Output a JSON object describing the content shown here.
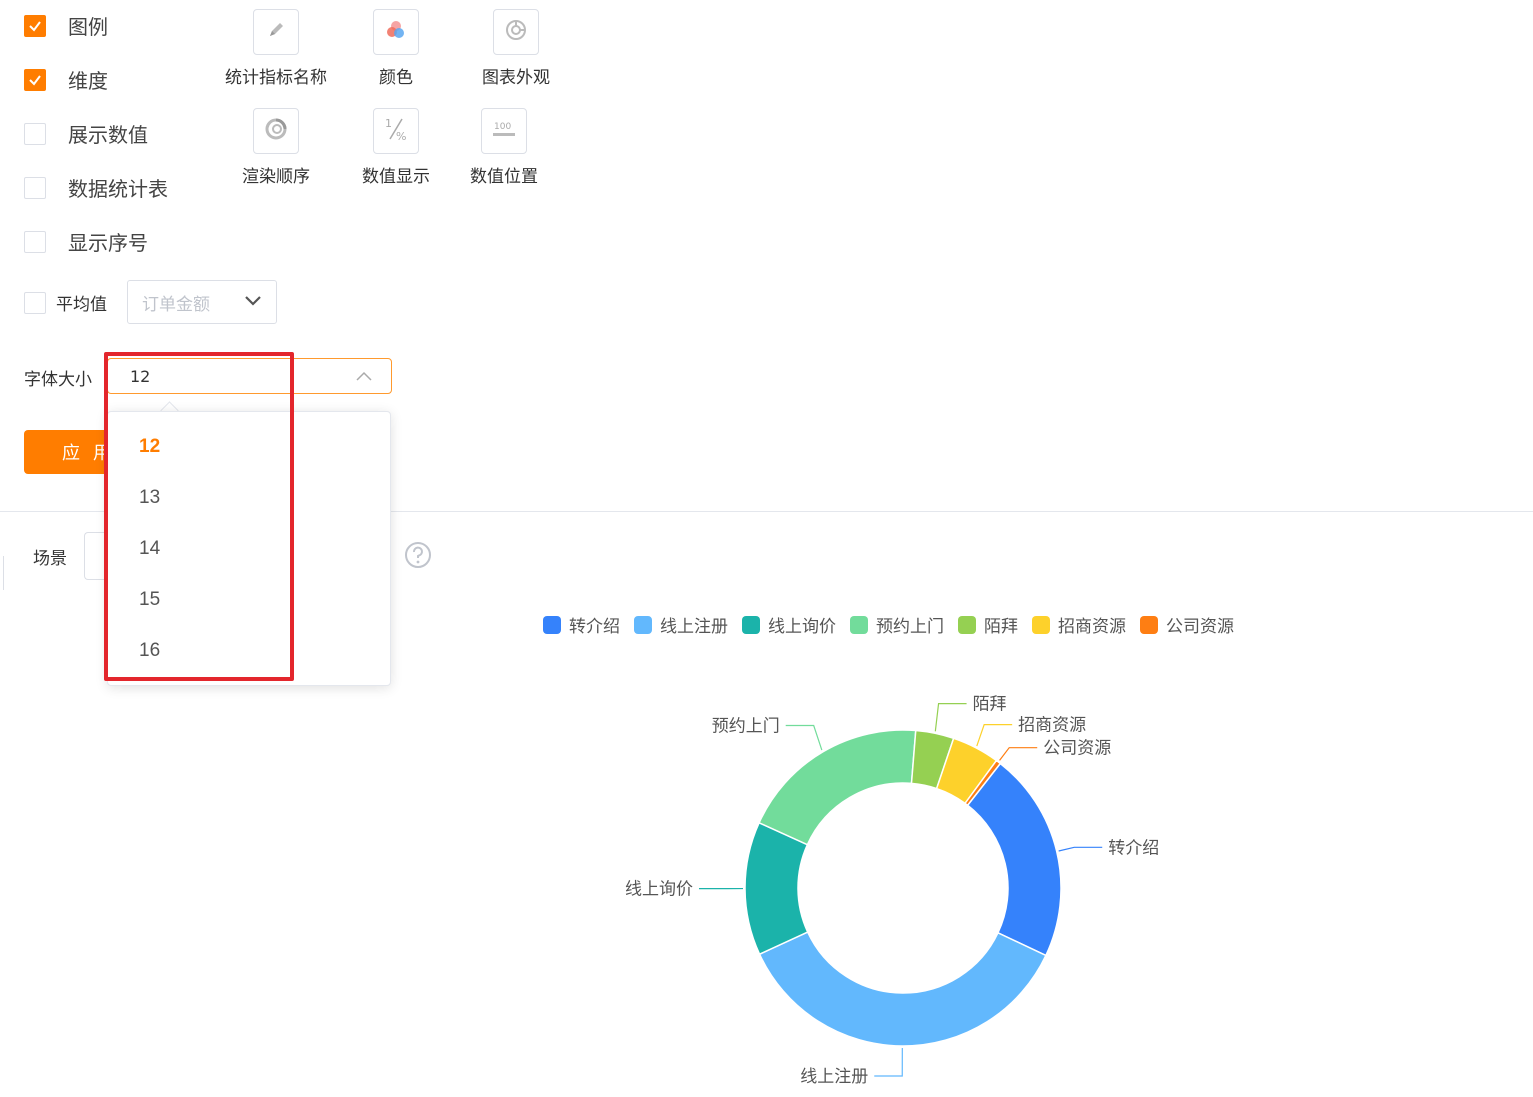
{
  "options": {
    "checkboxes": [
      {
        "label": "图例",
        "checked": true
      },
      {
        "label": "维度",
        "checked": true
      },
      {
        "label": "展示数值",
        "checked": false
      },
      {
        "label": "数据统计表",
        "checked": false
      },
      {
        "label": "显示序号",
        "checked": false
      }
    ]
  },
  "tools": [
    {
      "label": "统计指标名称",
      "icon": "pencil-icon"
    },
    {
      "label": "颜色",
      "icon": "color-palette-icon"
    },
    {
      "label": "图表外观",
      "icon": "chart-appearance-icon"
    },
    {
      "label": "渲染顺序",
      "icon": "render-order-icon"
    },
    {
      "label": "数值显示",
      "icon": "fraction-percent-icon"
    },
    {
      "label": "数值位置",
      "icon": "value-position-icon"
    }
  ],
  "average": {
    "label": "平均值",
    "checked": false,
    "select_placeholder": "订单金额"
  },
  "font_size": {
    "label": "字体大小",
    "value": "12",
    "options": [
      "12",
      "13",
      "14",
      "15",
      "16"
    ],
    "selected": "12"
  },
  "apply_label": "应 用",
  "scene_label": "场景",
  "colors": {
    "accent": "#ff7d00",
    "highlight": "#e3262c"
  },
  "chart_data": {
    "type": "pie",
    "donut": true,
    "legend_position": "top",
    "categories": [
      "转介绍",
      "线上注册",
      "线上询价",
      "预约上门",
      "陌拜",
      "招商资源",
      "公司资源"
    ],
    "values": [
      22,
      37,
      14,
      20,
      4,
      5,
      0.5
    ],
    "colors": [
      "#3582fb",
      "#62b8fd",
      "#1bb3aa",
      "#72dc9b",
      "#95d052",
      "#fdd12b",
      "#fe7e13"
    ]
  }
}
